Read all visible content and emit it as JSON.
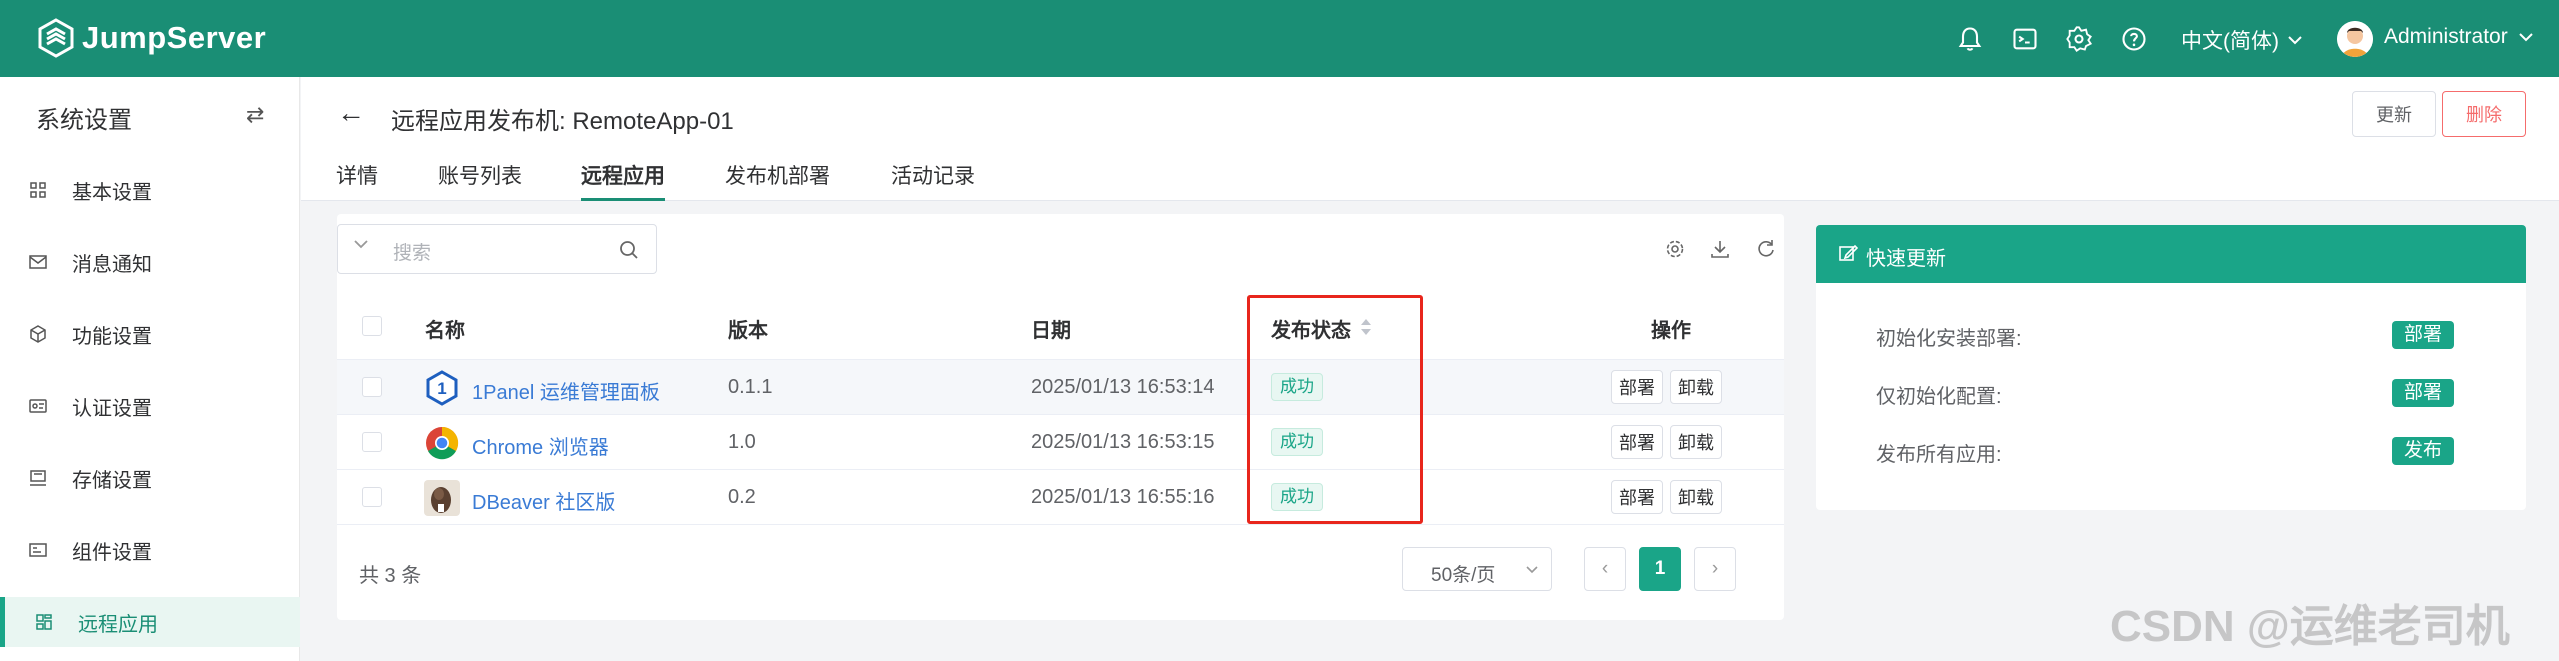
{
  "topbar": {
    "brand": "JumpServer",
    "language": "中文(简体)",
    "user": "Administrator",
    "icons": [
      "bell-icon",
      "terminal-icon",
      "gear-icon",
      "help-icon"
    ]
  },
  "sidebar": {
    "title": "系统设置",
    "items": [
      {
        "label": "基本设置",
        "icon": "grid-icon"
      },
      {
        "label": "消息通知",
        "icon": "mail-icon"
      },
      {
        "label": "功能设置",
        "icon": "cube-icon"
      },
      {
        "label": "认证设置",
        "icon": "id-card-icon"
      },
      {
        "label": "存储设置",
        "icon": "storage-icon"
      },
      {
        "label": "组件设置",
        "icon": "component-icon"
      },
      {
        "label": "远程应用",
        "icon": "apps-icon",
        "active": true
      }
    ]
  },
  "header": {
    "title": "远程应用发布机: RemoteApp-01",
    "update_label": "更新",
    "delete_label": "删除",
    "tabs": [
      {
        "label": "详情"
      },
      {
        "label": "账号列表"
      },
      {
        "label": "远程应用",
        "active": true
      },
      {
        "label": "发布机部署"
      },
      {
        "label": "活动记录"
      }
    ]
  },
  "table": {
    "search_placeholder": "搜索",
    "columns": {
      "name": "名称",
      "version": "版本",
      "date": "日期",
      "status": "发布状态",
      "actions": "操作"
    },
    "rows": [
      {
        "name": "1Panel 运维管理面板",
        "version": "0.1.1",
        "date": "2025/01/13 16:53:14",
        "status": "成功",
        "deploy": "部署",
        "uninstall": "卸载"
      },
      {
        "name": "Chrome 浏览器",
        "version": "1.0",
        "date": "2025/01/13 16:53:15",
        "status": "成功",
        "deploy": "部署",
        "uninstall": "卸载"
      },
      {
        "name": "DBeaver 社区版",
        "version": "0.2",
        "date": "2025/01/13 16:55:16",
        "status": "成功",
        "deploy": "部署",
        "uninstall": "卸载"
      }
    ],
    "total": "共 3 条",
    "page_size": "50条/页",
    "current_page": "1"
  },
  "quick_update": {
    "title": "快速更新",
    "rows": [
      {
        "label": "初始化安装部署:",
        "button": "部署"
      },
      {
        "label": "仅初始化配置:",
        "button": "部署"
      },
      {
        "label": "发布所有应用:",
        "button": "发布"
      }
    ]
  },
  "watermark": "CSDN @运维老司机",
  "colors": {
    "brand": "#1a8e75",
    "accent": "#1aa588",
    "danger": "#f56c6c",
    "highlight": "#e8261c"
  }
}
